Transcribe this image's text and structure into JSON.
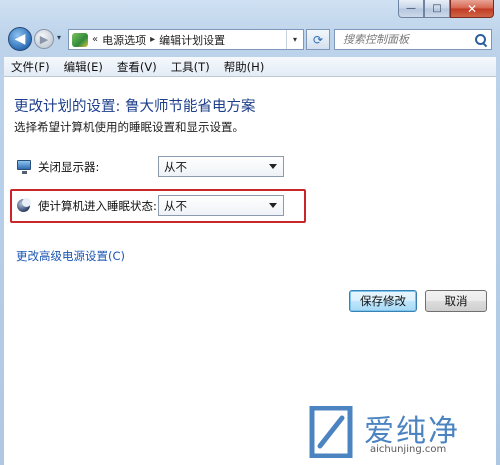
{
  "window": {
    "minimize_glyph": "—",
    "maximize_glyph": "□",
    "close_glyph": "✕"
  },
  "address": {
    "prefix": "«",
    "crumbs": [
      "电源选项",
      "编辑计划设置"
    ],
    "separator": "▸",
    "drop_glyph": "▾"
  },
  "search": {
    "placeholder": "搜索控制面板"
  },
  "menu": [
    "文件(F)",
    "编辑(E)",
    "查看(V)",
    "工具(T)",
    "帮助(H)"
  ],
  "main": {
    "title": "更改计划的设置: 鲁大师节能省电方案",
    "subtitle": "选择希望计算机使用的睡眠设置和显示设置。",
    "settings": [
      {
        "label": "关闭显示器:",
        "value": "从不",
        "icon": "monitor-icon"
      },
      {
        "label": "使计算机进入睡眠状态:",
        "value": "从不",
        "icon": "sleep-icon"
      }
    ],
    "advanced_link": "更改高级电源设置(C)",
    "save_label": "保存修改",
    "cancel_label": "取消"
  },
  "watermark": {
    "brand": "爱纯净",
    "url": "aichunjing.com"
  },
  "colors": {
    "title_blue": "#1e3f8c",
    "link_blue": "#1c56b5",
    "highlight_red": "#c9262c",
    "watermark_blue": "#2d6fb7"
  }
}
